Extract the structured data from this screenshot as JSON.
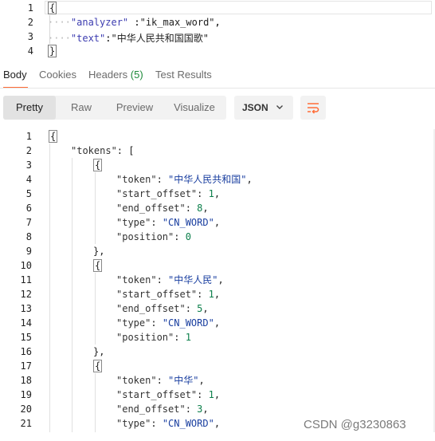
{
  "request": {
    "lines": [
      {
        "n": "1",
        "text": "{"
      },
      {
        "n": "2",
        "key": "\"analyzer\"",
        "sep": " :",
        "value": "\"ik_max_word\"",
        "tail": ","
      },
      {
        "n": "3",
        "key": "\"text\"",
        "sep": ":",
        "value": "\"中华人民共和国国歌\"",
        "tail": ""
      },
      {
        "n": "4",
        "text": "}"
      }
    ]
  },
  "tabs": [
    {
      "label": "Body",
      "active": true
    },
    {
      "label": "Cookies"
    },
    {
      "label": "Headers",
      "count": "(5)"
    },
    {
      "label": "Test Results"
    }
  ],
  "toolbar": {
    "views": [
      "Pretty",
      "Raw",
      "Preview",
      "Visualize"
    ],
    "active_view": "Pretty",
    "format": "JSON"
  },
  "response": {
    "lines": [
      {
        "n": "1",
        "indent": 0,
        "parts": [
          {
            "t": "{",
            "c": "jpunc",
            "box": true
          }
        ]
      },
      {
        "n": "2",
        "indent": 1,
        "parts": [
          {
            "t": "\"tokens\"",
            "c": "jkey"
          },
          {
            "t": ": [",
            "c": "jpunc"
          }
        ]
      },
      {
        "n": "3",
        "indent": 2,
        "parts": [
          {
            "t": "{",
            "c": "jpunc",
            "box": true
          }
        ]
      },
      {
        "n": "4",
        "indent": 3,
        "parts": [
          {
            "t": "\"token\"",
            "c": "jkey"
          },
          {
            "t": ": ",
            "c": "jpunc"
          },
          {
            "t": "\"中华人民共和国\"",
            "c": "jstr"
          },
          {
            "t": ",",
            "c": "jpunc"
          }
        ]
      },
      {
        "n": "5",
        "indent": 3,
        "parts": [
          {
            "t": "\"start_offset\"",
            "c": "jkey"
          },
          {
            "t": ": ",
            "c": "jpunc"
          },
          {
            "t": "1",
            "c": "jnum"
          },
          {
            "t": ",",
            "c": "jpunc"
          }
        ]
      },
      {
        "n": "6",
        "indent": 3,
        "parts": [
          {
            "t": "\"end_offset\"",
            "c": "jkey"
          },
          {
            "t": ": ",
            "c": "jpunc"
          },
          {
            "t": "8",
            "c": "jnum"
          },
          {
            "t": ",",
            "c": "jpunc"
          }
        ]
      },
      {
        "n": "7",
        "indent": 3,
        "parts": [
          {
            "t": "\"type\"",
            "c": "jkey"
          },
          {
            "t": ": ",
            "c": "jpunc"
          },
          {
            "t": "\"CN_WORD\"",
            "c": "jstr"
          },
          {
            "t": ",",
            "c": "jpunc"
          }
        ]
      },
      {
        "n": "8",
        "indent": 3,
        "parts": [
          {
            "t": "\"position\"",
            "c": "jkey"
          },
          {
            "t": ": ",
            "c": "jpunc"
          },
          {
            "t": "0",
            "c": "jnum"
          }
        ]
      },
      {
        "n": "9",
        "indent": 2,
        "parts": [
          {
            "t": "},",
            "c": "jpunc"
          }
        ]
      },
      {
        "n": "10",
        "indent": 2,
        "parts": [
          {
            "t": "{",
            "c": "jpunc",
            "box": true
          }
        ]
      },
      {
        "n": "11",
        "indent": 3,
        "parts": [
          {
            "t": "\"token\"",
            "c": "jkey"
          },
          {
            "t": ": ",
            "c": "jpunc"
          },
          {
            "t": "\"中华人民\"",
            "c": "jstr"
          },
          {
            "t": ",",
            "c": "jpunc"
          }
        ]
      },
      {
        "n": "12",
        "indent": 3,
        "parts": [
          {
            "t": "\"start_offset\"",
            "c": "jkey"
          },
          {
            "t": ": ",
            "c": "jpunc"
          },
          {
            "t": "1",
            "c": "jnum"
          },
          {
            "t": ",",
            "c": "jpunc"
          }
        ]
      },
      {
        "n": "13",
        "indent": 3,
        "parts": [
          {
            "t": "\"end_offset\"",
            "c": "jkey"
          },
          {
            "t": ": ",
            "c": "jpunc"
          },
          {
            "t": "5",
            "c": "jnum"
          },
          {
            "t": ",",
            "c": "jpunc"
          }
        ]
      },
      {
        "n": "14",
        "indent": 3,
        "parts": [
          {
            "t": "\"type\"",
            "c": "jkey"
          },
          {
            "t": ": ",
            "c": "jpunc"
          },
          {
            "t": "\"CN_WORD\"",
            "c": "jstr"
          },
          {
            "t": ",",
            "c": "jpunc"
          }
        ]
      },
      {
        "n": "15",
        "indent": 3,
        "parts": [
          {
            "t": "\"position\"",
            "c": "jkey"
          },
          {
            "t": ": ",
            "c": "jpunc"
          },
          {
            "t": "1",
            "c": "jnum"
          }
        ]
      },
      {
        "n": "16",
        "indent": 2,
        "parts": [
          {
            "t": "},",
            "c": "jpunc"
          }
        ]
      },
      {
        "n": "17",
        "indent": 2,
        "parts": [
          {
            "t": "{",
            "c": "jpunc",
            "box": true
          }
        ]
      },
      {
        "n": "18",
        "indent": 3,
        "parts": [
          {
            "t": "\"token\"",
            "c": "jkey"
          },
          {
            "t": ": ",
            "c": "jpunc"
          },
          {
            "t": "\"中华\"",
            "c": "jstr"
          },
          {
            "t": ",",
            "c": "jpunc"
          }
        ]
      },
      {
        "n": "19",
        "indent": 3,
        "parts": [
          {
            "t": "\"start_offset\"",
            "c": "jkey"
          },
          {
            "t": ": ",
            "c": "jpunc"
          },
          {
            "t": "1",
            "c": "jnum"
          },
          {
            "t": ",",
            "c": "jpunc"
          }
        ]
      },
      {
        "n": "20",
        "indent": 3,
        "parts": [
          {
            "t": "\"end_offset\"",
            "c": "jkey"
          },
          {
            "t": ": ",
            "c": "jpunc"
          },
          {
            "t": "3",
            "c": "jnum"
          },
          {
            "t": ",",
            "c": "jpunc"
          }
        ]
      },
      {
        "n": "21",
        "indent": 3,
        "parts": [
          {
            "t": "\"type\"",
            "c": "jkey"
          },
          {
            "t": ": ",
            "c": "jpunc"
          },
          {
            "t": "\"CN_WORD\"",
            "c": "jstr"
          },
          {
            "t": ",",
            "c": "jpunc"
          }
        ]
      }
    ]
  },
  "watermark": "CSDN @g3230863",
  "colors": {
    "accent": "#ff6c37",
    "count_green": "#1e8a3a",
    "string_blue": "#1a3fa0",
    "number_green": "#0b7f4a"
  }
}
